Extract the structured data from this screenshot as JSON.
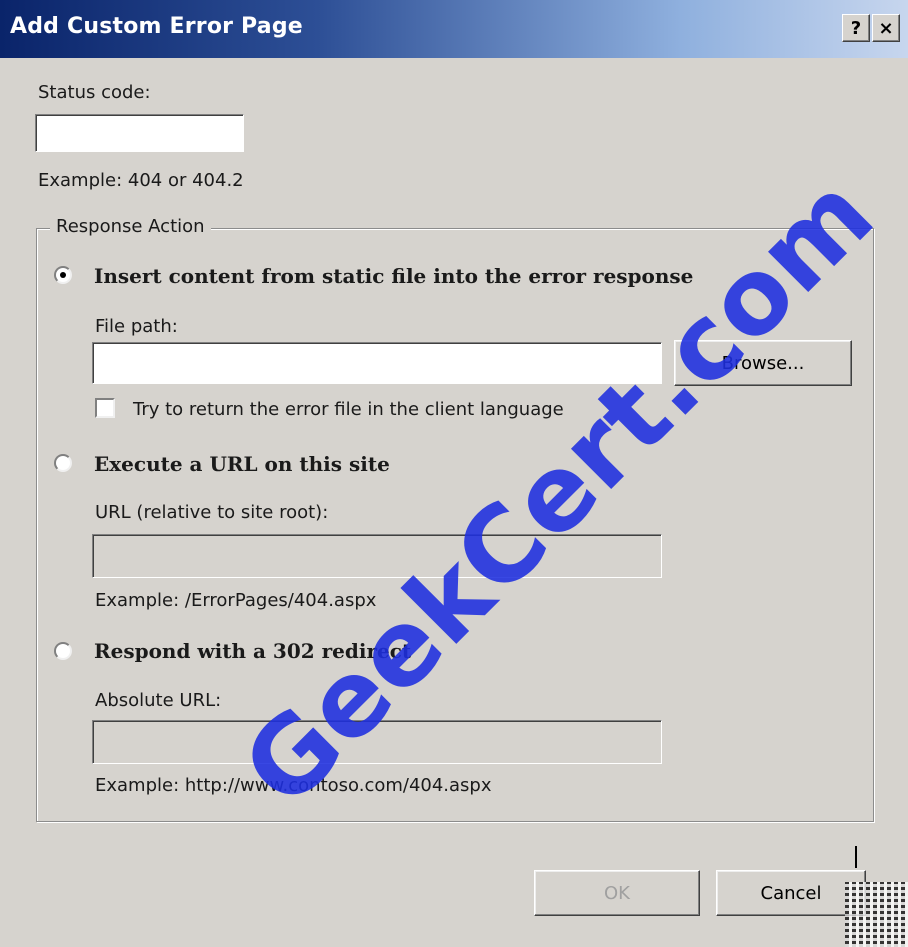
{
  "window": {
    "title": "Add Custom Error Page",
    "help_button": "?",
    "close_button": "×"
  },
  "status_code": {
    "label": "Status code:",
    "value": "",
    "example": "Example: 404 or 404.2"
  },
  "response_action": {
    "legend": "Response Action",
    "options": [
      {
        "label": "Insert content from static file into the error response",
        "selected": true
      },
      {
        "label": "Execute a URL on this site",
        "selected": false
      },
      {
        "label": "Respond with a 302 redirect",
        "selected": false
      }
    ],
    "static_file": {
      "file_path_label": "File path:",
      "file_path_value": "",
      "browse_label": "Browse...",
      "client_language_label": "Try to return the error file in the client language",
      "client_language_checked": false
    },
    "execute_url": {
      "url_label": "URL (relative to site root):",
      "url_value": "",
      "example": "Example: /ErrorPages/404.aspx"
    },
    "redirect": {
      "absolute_url_label": "Absolute URL:",
      "absolute_url_value": "",
      "example": "Example: http://www.contoso.com/404.aspx"
    }
  },
  "footer": {
    "ok_label": "OK",
    "cancel_label": "Cancel"
  },
  "watermark": "GeekCert.com"
}
